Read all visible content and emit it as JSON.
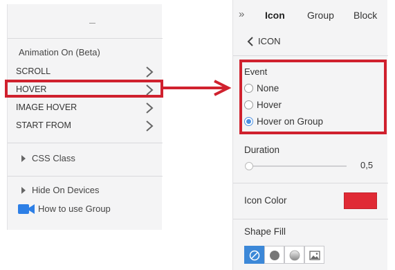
{
  "left_panel": {
    "animation_title": "Animation On (Beta)",
    "menu_items": [
      {
        "label": "SCROLL"
      },
      {
        "label": "HOVER"
      },
      {
        "label": "IMAGE HOVER"
      },
      {
        "label": "START FROM"
      }
    ],
    "css_class_label": "CSS Class",
    "hide_on_devices_label": "Hide On Devices",
    "how_to_label": "How to use Group"
  },
  "right_panel": {
    "tabs": [
      {
        "label": "Icon",
        "active": true
      },
      {
        "label": "Group",
        "active": false
      },
      {
        "label": "Block",
        "active": false
      }
    ],
    "back_label": "ICON",
    "event": {
      "label": "Event",
      "options": [
        {
          "label": "None",
          "selected": false
        },
        {
          "label": "Hover",
          "selected": false
        },
        {
          "label": "Hover on Group",
          "selected": true
        }
      ]
    },
    "duration": {
      "label": "Duration",
      "value": "0,5"
    },
    "icon_color": {
      "label": "Icon Color",
      "value": "#e02a35"
    },
    "shape_fill": {
      "label": "Shape Fill",
      "options": [
        "none-icon",
        "circle-filled-icon",
        "circle-gradient-icon",
        "image-icon"
      ],
      "selected": "none-icon"
    }
  },
  "colors": {
    "highlight": "#d0212e",
    "accent": "#3c88d8",
    "panel_bg": "#f4f4f5"
  }
}
